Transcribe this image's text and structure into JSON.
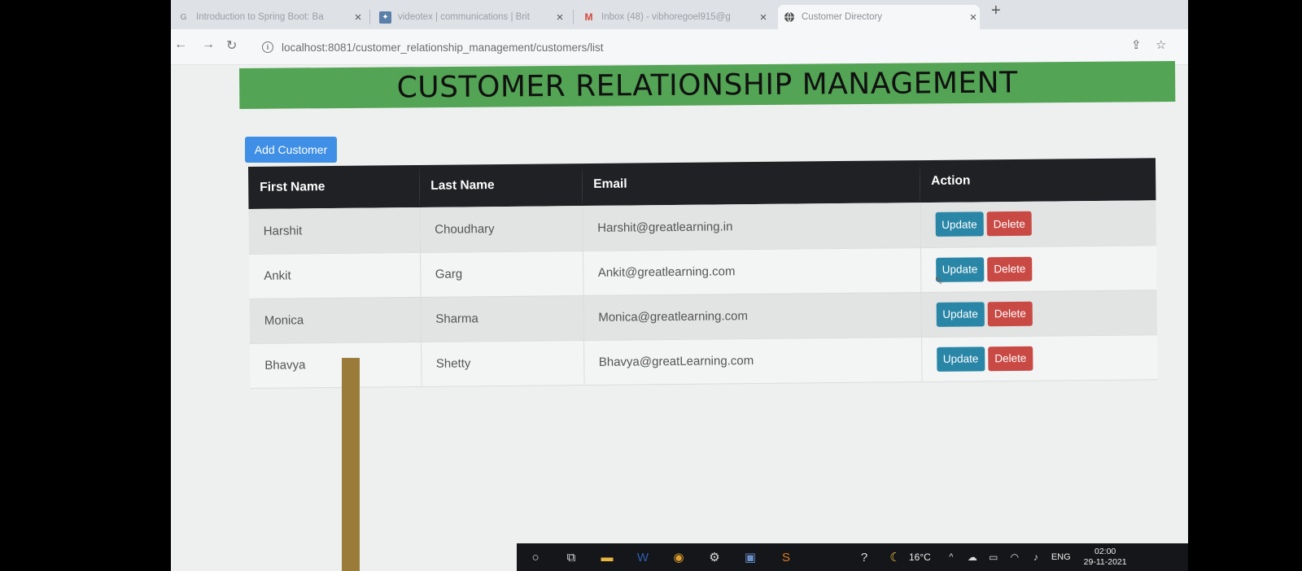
{
  "browser": {
    "tabs": [
      {
        "title": "Introduction to Spring Boot: Ba",
        "icon": "google-icon",
        "active": false
      },
      {
        "title": "videotex | communications | Brit",
        "icon": "britannica-icon",
        "active": false
      },
      {
        "title": "Inbox (48) - vibhoregoel915@g",
        "icon": "gmail-icon",
        "active": false
      },
      {
        "title": "Customer Directory",
        "icon": "globe-icon",
        "active": true
      }
    ],
    "new_tab_symbol": "+",
    "url": "localhost:8081/customer_relationship_management/customers/list"
  },
  "page": {
    "heading": "CUSTOMER RELATIONSHIP MANAGEMENT",
    "add_button_label": "Add Customer",
    "table": {
      "headers": [
        "First Name",
        "Last Name",
        "Email",
        "Action"
      ],
      "rows": [
        {
          "first": "Harshit",
          "last": "Choudhary",
          "email": "Harshit@greatlearning.in"
        },
        {
          "first": "Ankit",
          "last": "Garg",
          "email": "Ankit@greatlearning.com"
        },
        {
          "first": "Monica",
          "last": "Sharma",
          "email": "Monica@greatlearning.com"
        },
        {
          "first": "Bhavya",
          "last": "Shetty",
          "email": "Bhavya@greatLearning.com"
        }
      ],
      "update_label": "Update",
      "delete_label": "Delete"
    }
  },
  "taskbar": {
    "temperature": "16°C",
    "language": "ENG",
    "time": "02:00",
    "date": "29-11-2021"
  },
  "colors": {
    "banner": "#53a454",
    "add_button": "#3f8fe6",
    "update_button": "#2a86a6",
    "delete_button": "#c94a45",
    "table_header": "#1f2124"
  }
}
